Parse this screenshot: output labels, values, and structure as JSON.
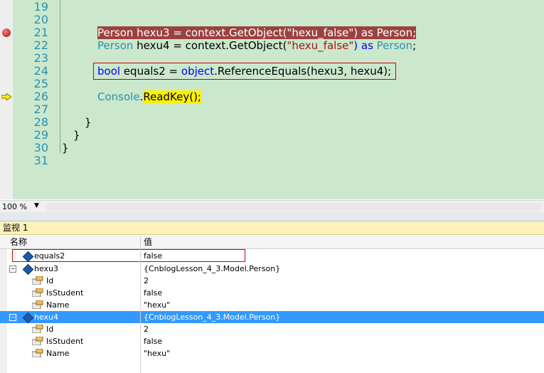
{
  "editor": {
    "lines": [
      {
        "num": "19"
      },
      {
        "num": "20"
      },
      {
        "num": "21"
      },
      {
        "num": "22"
      },
      {
        "num": "23"
      },
      {
        "num": "24"
      },
      {
        "num": "25"
      },
      {
        "num": "26"
      },
      {
        "num": "27"
      },
      {
        "num": "28"
      },
      {
        "num": "29"
      },
      {
        "num": "30"
      },
      {
        "num": "31"
      }
    ],
    "code": {
      "l21": {
        "type1": "Person",
        "mid": " hexu3 = context.GetObject(",
        "str": "\"hexu_false\"",
        "as": ") as ",
        "type2": "Person",
        "end": ";"
      },
      "l22": {
        "type1": "Person",
        "mid": " hexu4 = context.GetObject(",
        "str": "\"hexu_false\"",
        "as": ") as ",
        "type2": "Person",
        "end": ";"
      },
      "l24": {
        "kw": "bool",
        "mid": " equals2 = ",
        "kw2": "object",
        "rest": ".ReferenceEquals(hexu3, hexu4);"
      },
      "l26": {
        "cls": "Console",
        "dot": ".",
        "call": "ReadKey();"
      },
      "l28": "}",
      "l29": "}",
      "l30": "}"
    },
    "zoom": "100 %"
  },
  "watch": {
    "title": "监视 1",
    "col_name": "名称",
    "col_value": "值",
    "rows": [
      {
        "name": "equals2",
        "value": "false"
      },
      {
        "name": "hexu3",
        "value": "{CnblogLesson_4_3.Model.Person}"
      },
      {
        "name": "Id",
        "value": "2"
      },
      {
        "name": "IsStudent",
        "value": "false"
      },
      {
        "name": "Name",
        "value": "\"hexu\""
      },
      {
        "name": "hexu4",
        "value": "{CnblogLesson_4_3.Model.Person}"
      },
      {
        "name": "Id",
        "value": "2"
      },
      {
        "name": "IsStudent",
        "value": "false"
      },
      {
        "name": "Name",
        "value": "\"hexu\""
      }
    ],
    "expand_collapse_symbol": "−"
  },
  "colors": {
    "editor_bg": "#cbe8cc",
    "breakpoint_line": "#9b4240",
    "line_number": "#2b91af",
    "keyword": "#0000ff",
    "type": "#2b91af",
    "string": "#a31515",
    "selection": "#3399ff",
    "watch_title_bg": "#fff2b8"
  }
}
